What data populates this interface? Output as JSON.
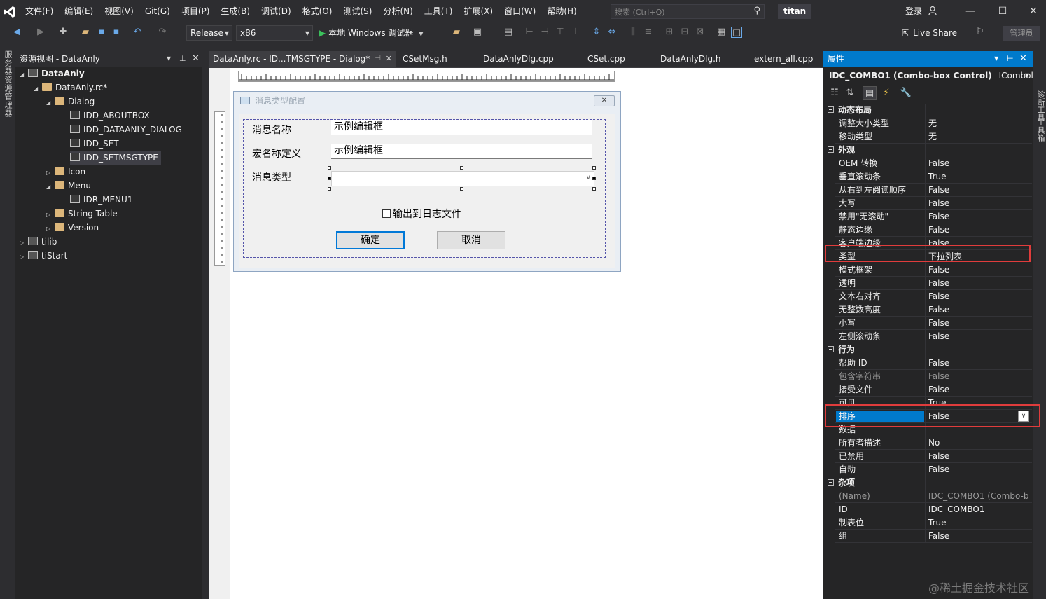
{
  "menubar": {
    "items": [
      "文件(F)",
      "编辑(E)",
      "视图(V)",
      "Git(G)",
      "项目(P)",
      "生成(B)",
      "调试(D)",
      "格式(O)",
      "测试(S)",
      "分析(N)",
      "工具(T)",
      "扩展(X)",
      "窗口(W)",
      "帮助(H)"
    ],
    "search_placeholder": "搜索 (Ctrl+Q)",
    "solution_name": "titan",
    "login": "登录",
    "window_buttons": [
      "—",
      "☐",
      "✕"
    ]
  },
  "toolbar": {
    "configuration": "Release",
    "platform": "x86",
    "run_label": "本地 Windows 调试器",
    "liveshare": "Live Share",
    "admin": "管理员"
  },
  "left_strip": {
    "label": "服务器资源管理器"
  },
  "resource_view": {
    "title": "资源视图 - DataAnly",
    "tree": [
      {
        "label": "DataAnly",
        "bold": true
      },
      {
        "label": "DataAnly.rc*"
      },
      {
        "label": "Dialog"
      },
      {
        "label": "IDD_ABOUTBOX"
      },
      {
        "label": "IDD_DATAANLY_DIALOG"
      },
      {
        "label": "IDD_SET"
      },
      {
        "label": "IDD_SETMSGTYPE"
      },
      {
        "label": "Icon"
      },
      {
        "label": "Menu"
      },
      {
        "label": "IDR_MENU1"
      },
      {
        "label": "String Table"
      },
      {
        "label": "Version"
      },
      {
        "label": "tilib"
      },
      {
        "label": "tiStart"
      }
    ]
  },
  "doc_tabs": [
    {
      "label": "DataAnly.rc - ID...TMSGTYPE - Dialog*",
      "active": true
    },
    {
      "label": "CSetMsg.h"
    },
    {
      "label": "DataAnlyDlg.cpp"
    },
    {
      "label": "CSet.cpp"
    },
    {
      "label": "DataAnlyDlg.h"
    },
    {
      "label": "extern_all.cpp"
    }
  ],
  "dialog": {
    "title": "消息类型配置",
    "labels": {
      "msg_name": "消息名称",
      "macro_name": "宏名称定义",
      "msg_type": "消息类型"
    },
    "edits": {
      "msg_name": "示例编辑框",
      "macro_name": "示例编辑框"
    },
    "checkbox": "输出到日志文件",
    "ok": "确定",
    "cancel": "取消"
  },
  "properties": {
    "title": "属性",
    "object": "IDC_COMBO1 (Combo-box Control)",
    "object_type": "ICombol",
    "categories": [
      {
        "name": "动态布局",
        "rows": [
          [
            "调整大小类型",
            "无"
          ],
          [
            "移动类型",
            "无"
          ]
        ]
      },
      {
        "name": "外观",
        "rows": [
          [
            "OEM 转换",
            "False"
          ],
          [
            "垂直滚动条",
            "True"
          ],
          [
            "从右到左阅读顺序",
            "False"
          ],
          [
            "大写",
            "False"
          ],
          [
            "禁用\"无滚动\"",
            "False"
          ],
          [
            "静态边缘",
            "False"
          ],
          [
            "客户端边缘",
            "False"
          ],
          [
            "类型",
            "下拉列表"
          ],
          [
            "模式框架",
            "False"
          ],
          [
            "透明",
            "False"
          ],
          [
            "文本右对齐",
            "False"
          ],
          [
            "无整数高度",
            "False"
          ],
          [
            "小写",
            "False"
          ],
          [
            "左侧滚动条",
            "False"
          ]
        ]
      },
      {
        "name": "行为",
        "rows": [
          [
            "帮助 ID",
            "False"
          ],
          [
            "包含字符串",
            "False"
          ],
          [
            "接受文件",
            "False"
          ],
          [
            "可见",
            "True"
          ],
          [
            "排序",
            "False"
          ],
          [
            "数据",
            ""
          ],
          [
            "所有者描述",
            "No"
          ],
          [
            "已禁用",
            "False"
          ],
          [
            "自动",
            "False"
          ]
        ]
      },
      {
        "name": "杂项",
        "rows": [
          [
            "(Name)",
            "IDC_COMBO1 (Combo-b"
          ],
          [
            "ID",
            "IDC_COMBO1"
          ],
          [
            "制表位",
            "True"
          ],
          [
            "组",
            "False"
          ]
        ]
      }
    ]
  },
  "right_strip": {
    "labels": [
      "诊断工具",
      "工具箱"
    ]
  },
  "watermark": "@稀土掘金技术社区",
  "colors": {
    "accent": "#007acc",
    "highlight_box": "#e03c3c",
    "run_green": "#3bc15c"
  }
}
